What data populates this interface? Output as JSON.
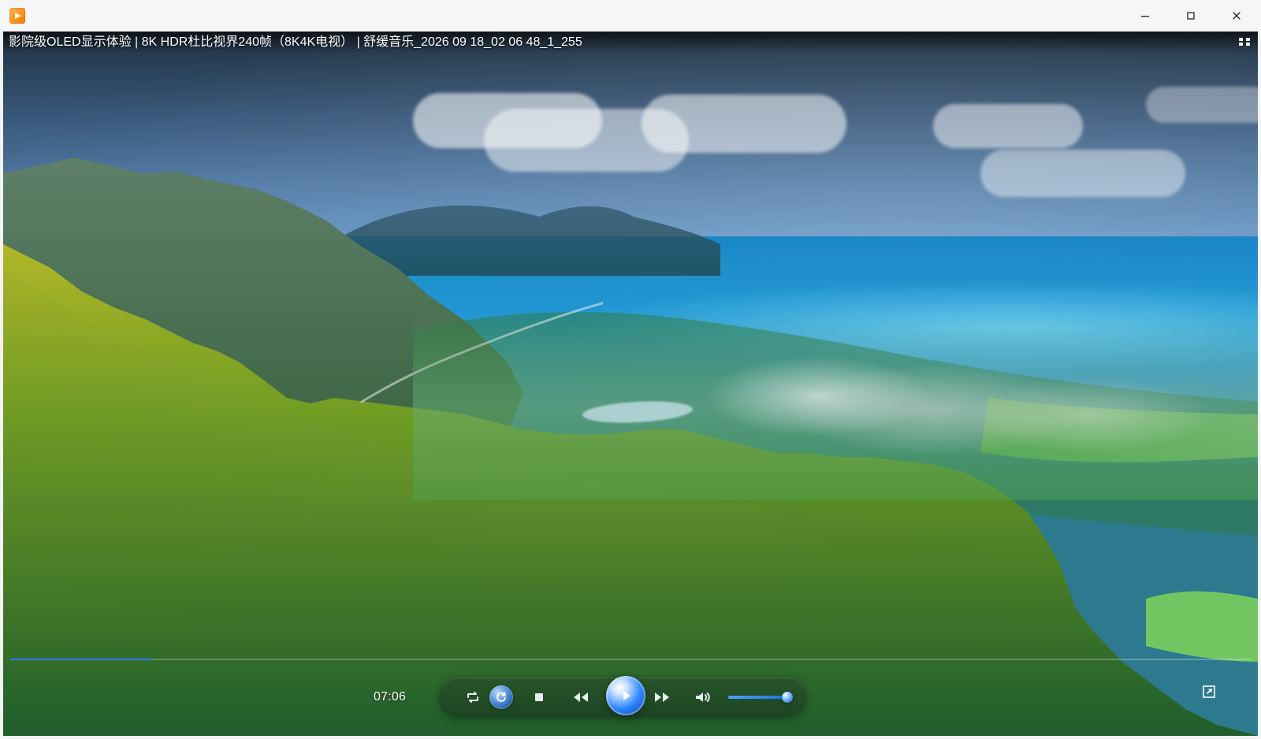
{
  "window": {
    "controls": {
      "minimize_icon": "minimize-icon",
      "maximize_icon": "maximize-icon",
      "close_icon": "close-icon"
    },
    "app_icon": "media-player-icon"
  },
  "video": {
    "title": "影院级OLED显示体验 | 8K HDR杜比视界240帧（8K4K电视） | 舒缓音乐_2026 09 18_02 06 48_1_255",
    "current_time": "07:06",
    "progress_fraction": 0.115,
    "volume_fraction": 0.92
  },
  "player": {
    "repeat_icon": "repeat-icon",
    "loop_icon": "loop-icon",
    "stop_icon": "stop-icon",
    "previous_icon": "rewind-icon",
    "play_icon": "play-icon",
    "next_icon": "fast-forward-icon",
    "volume_icon": "volume-icon",
    "expand_icon": "expand-icon",
    "grid_icon": "grid-icon"
  },
  "colors": {
    "accent": "#2c79ff"
  }
}
